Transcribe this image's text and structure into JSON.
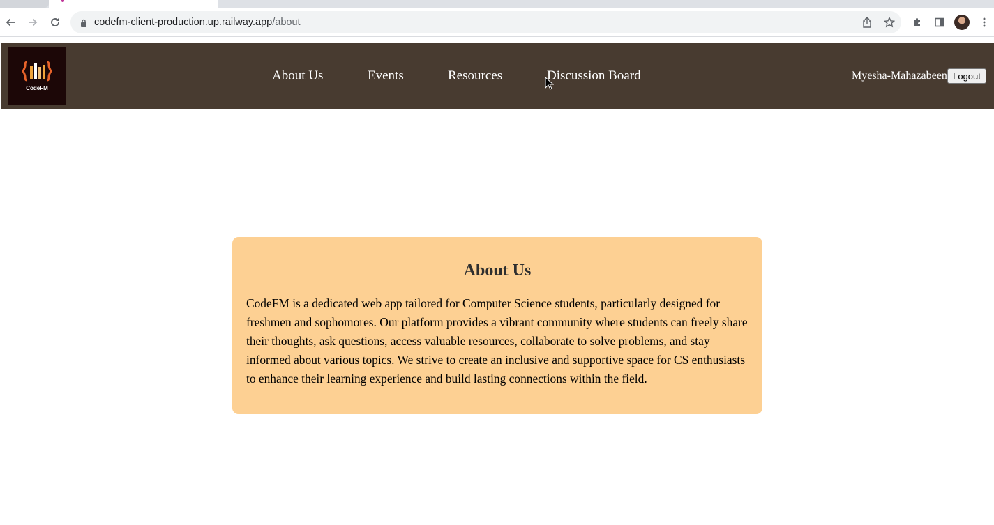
{
  "browser": {
    "url_host": "codefm-client-production.up.railway.app",
    "url_path": "/about",
    "icons": [
      "back-arrow-icon",
      "forward-arrow-icon",
      "reload-icon",
      "lock-icon",
      "share-icon",
      "bookmark-star-icon",
      "extensions-icon",
      "side-panel-icon",
      "profile-avatar",
      "menu-kebab-icon"
    ]
  },
  "header": {
    "logo_text": "CodeFM",
    "nav": [
      "About Us",
      "Events",
      "Resources",
      "Discussion Board"
    ],
    "username": "Myesha-Mahazabeen",
    "logout_label": "Logout"
  },
  "about": {
    "title": "About Us",
    "body": "CodeFM is a dedicated web app tailored for Computer Science students, particularly designed for freshmen and sophomores. Our platform provides a vibrant community where students can freely share their thoughts, ask questions, access valuable resources, collaborate to solve problems, and stay informed about various topics. We strive to create an inclusive and supportive space for CS enthusiasts to enhance their learning experience and build lasting connections within the field."
  },
  "colors": {
    "header_bg": "#483b30",
    "card_bg": "#fdd093",
    "logo_bg": "#1c0707"
  }
}
